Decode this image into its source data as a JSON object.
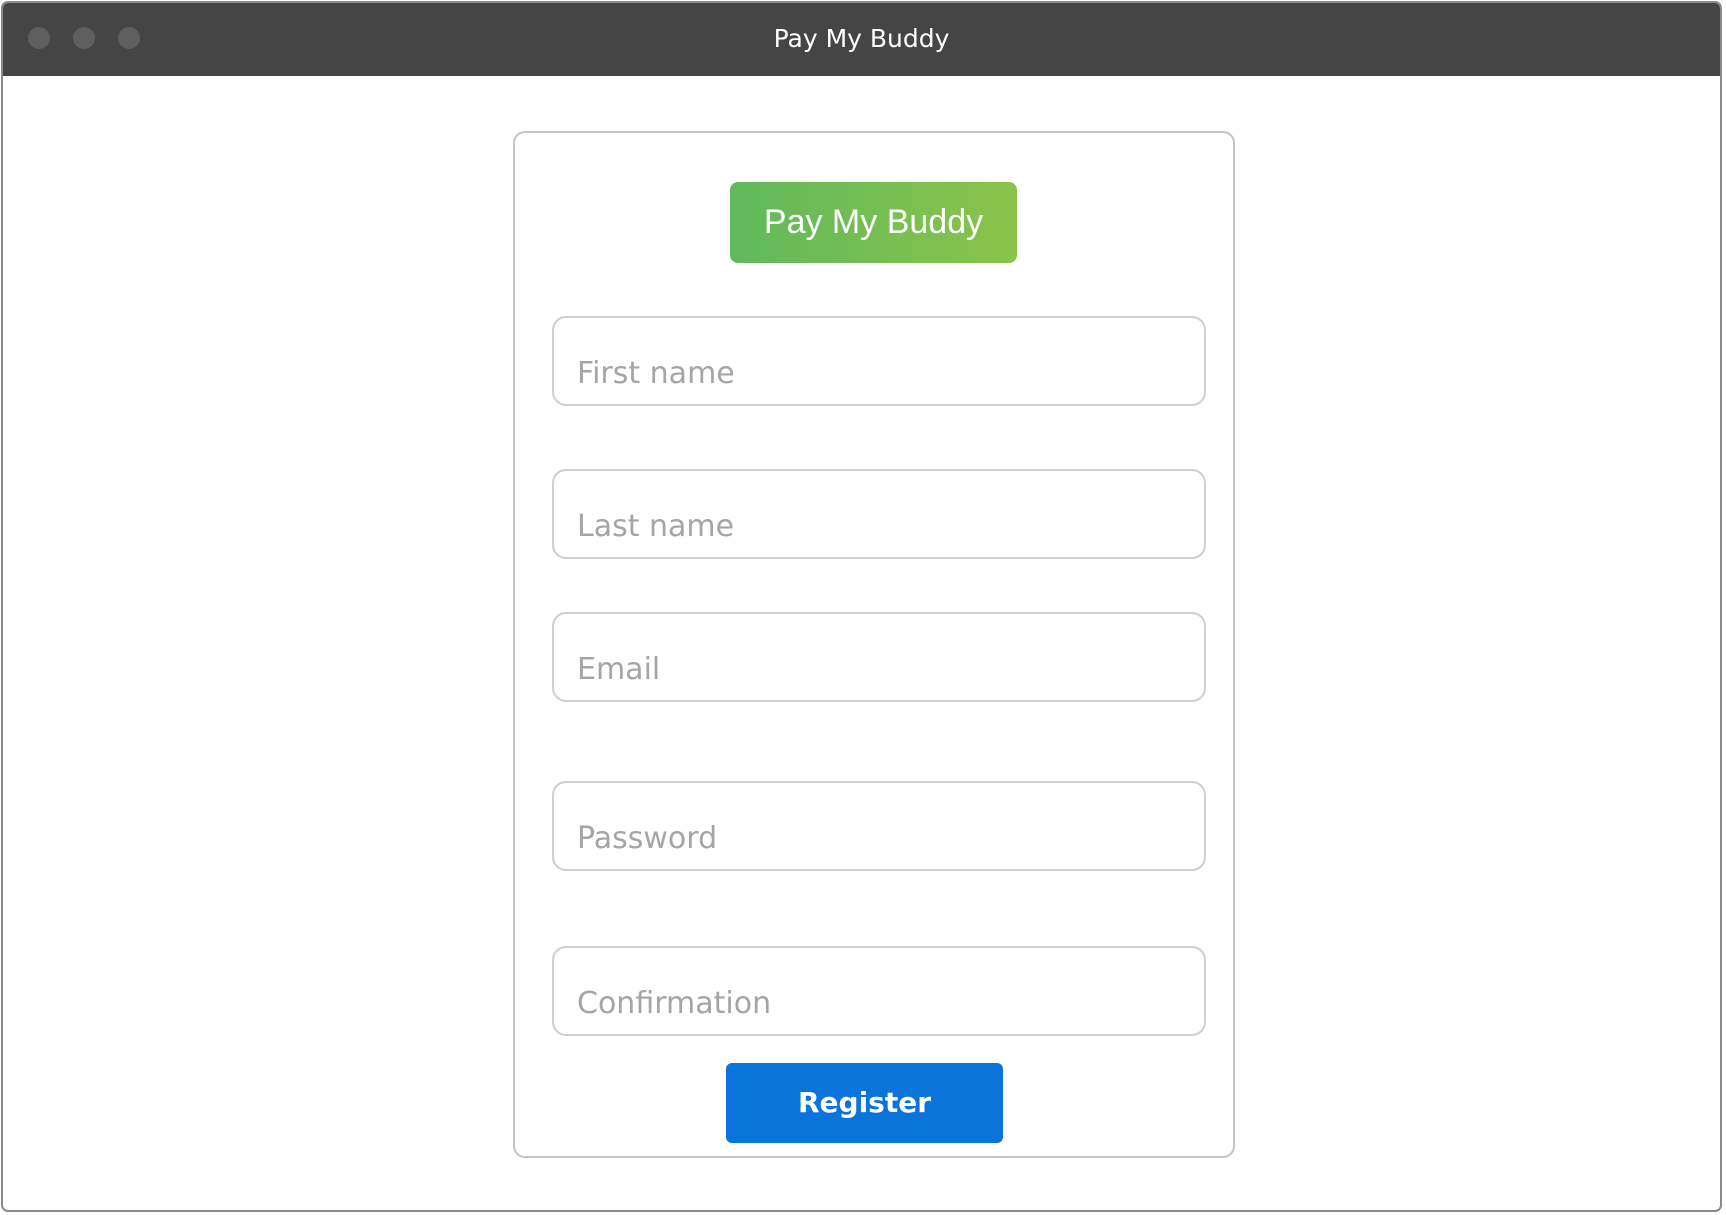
{
  "window": {
    "title": "Pay My Buddy"
  },
  "form": {
    "logo_text": "Pay My Buddy",
    "fields": [
      {
        "placeholder": "First name"
      },
      {
        "placeholder": "Last name"
      },
      {
        "placeholder": "Email"
      },
      {
        "placeholder": "Password"
      },
      {
        "placeholder": "Confirmation"
      }
    ],
    "register_label": "Register"
  },
  "colors": {
    "titlebar": "#454545",
    "logo_gradient_start": "#60b95c",
    "logo_gradient_end": "#8bc34a",
    "primary_button": "#0a74da"
  }
}
